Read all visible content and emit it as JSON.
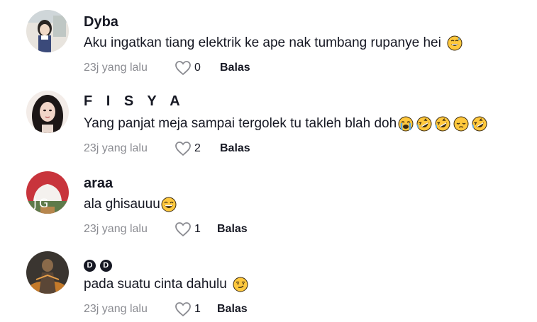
{
  "comments": [
    {
      "username": "Dyba",
      "text": "Aku ingatkan tiang elektrik ke ape nak tumbang rupanye hei",
      "emojis": [
        "grinning-sweat-emoji"
      ],
      "time": "23j yang lalu",
      "likes": "0",
      "reply_label": "Balas"
    },
    {
      "username": "F I S Y A",
      "text": "Yang panjat meja sampai tergolek tu takleh blah doh",
      "emojis": [
        "loudly-crying-emoji",
        "rolling-laughing-emoji",
        "rolling-laughing-emoji",
        "pensive-emoji",
        "rolling-laughing-emoji"
      ],
      "time": "23j yang lalu",
      "likes": "2",
      "reply_label": "Balas"
    },
    {
      "username": "araa",
      "text": "ala ghisauuu",
      "emojis": [
        "laughing-emoji"
      ],
      "time": "23j yang lalu",
      "likes": "1",
      "reply_label": "Balas"
    },
    {
      "username": "DD",
      "text": "pada suatu cinta dahulu",
      "emojis": [
        "smirking-emoji"
      ],
      "time": "23j yang lalu",
      "likes": "1",
      "reply_label": "Balas"
    }
  ],
  "avatar3_logo_text": "JG",
  "icons": {
    "like": "heart-outline-icon"
  },
  "colors": {
    "text": "#161823",
    "muted": "#8a8b91",
    "emoji_face": "#FFC83D"
  }
}
